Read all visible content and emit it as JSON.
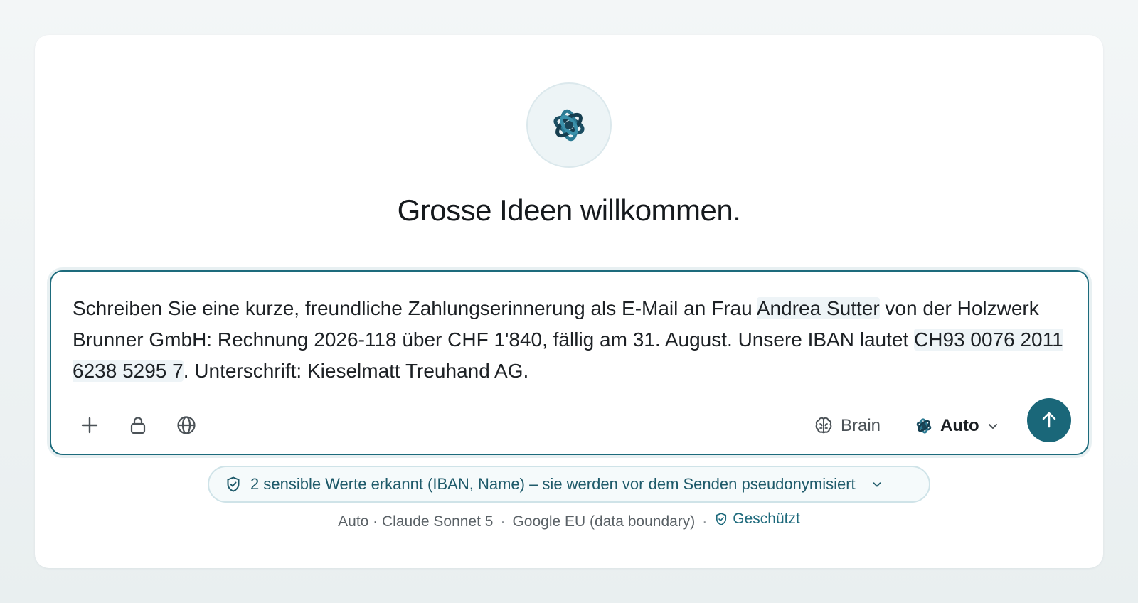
{
  "heading": "Grosse Ideen willkommen.",
  "prompt": {
    "part1": "Schreiben Sie eine kurze, freundliche Zahlungserinnerung als E-Mail an Frau ",
    "name": "Andrea Sutter",
    "part2": " von der Holzwerk Brunner GmbH: Rechnung 2026-118 über CHF 1'840, fällig am 31. August. Unsere IBAN lautet ",
    "iban": "CH93 0076 2011 6238 5295 7",
    "part3": ". Unterschrift: Kieselmatt Treuhand AG."
  },
  "toolbar": {
    "brain_label": "Brain",
    "model_label": "Auto"
  },
  "notice": {
    "text": "2 sensible Werte erkannt (IBAN, Name) – sie werden vor dem Senden pseudonymisiert"
  },
  "footer": {
    "model": "Auto · Claude Sonnet 5",
    "region": "Google EU (data boundary)",
    "protected": "Geschützt"
  },
  "colors": {
    "accent": "#1a6779",
    "border": "#1d6b7c"
  },
  "icons": [
    "logo-icon",
    "plus-icon",
    "lock-icon",
    "globe-icon",
    "brain-icon",
    "model-logo-icon",
    "chevron-down-icon",
    "arrow-up-icon",
    "shield-check-icon"
  ]
}
